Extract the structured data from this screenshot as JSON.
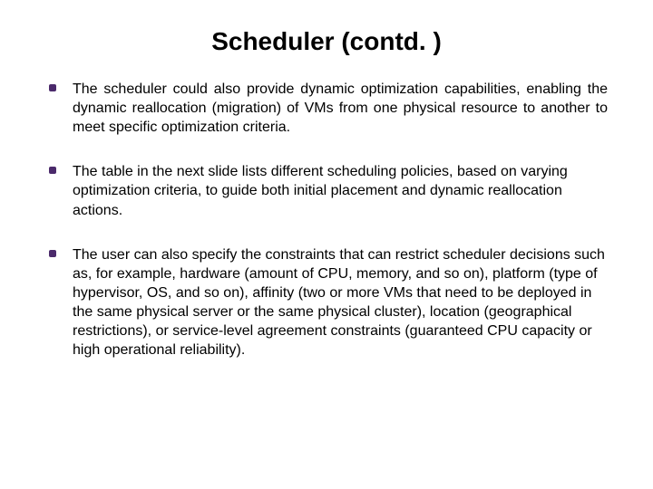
{
  "title": "Scheduler (contd. )",
  "bullets": [
    {
      "text": "The scheduler could also provide dynamic optimization capabilities, enabling the dynamic reallocation (migration) of VMs from one physical resource to another to meet specific optimization criteria.",
      "justify": true
    },
    {
      "text": "The table in the next slide lists different scheduling policies, based on varying optimization criteria, to guide both initial placement and dynamic reallocation actions.",
      "justify": false
    },
    {
      "text": "The user can also specify the constraints that can restrict scheduler decisions such as, for example, hardware (amount of CPU, memory, and so on), platform (type of hypervisor, OS, and so on), affinity (two or more VMs that need to be deployed in the same physical server or the same physical cluster), location (geographical restrictions), or service-level agreement constraints (guaranteed CPU capacity or high operational reliability).",
      "justify": false
    }
  ]
}
